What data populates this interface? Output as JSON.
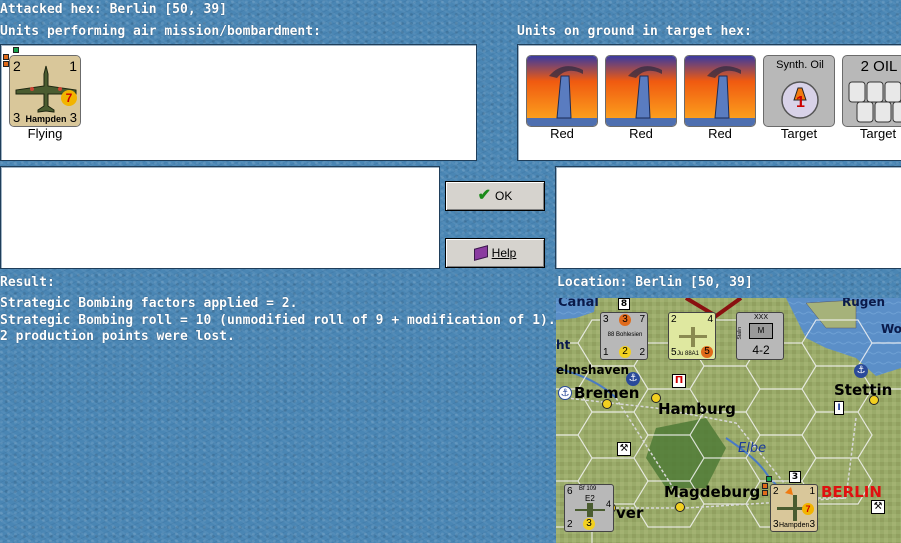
{
  "header": {
    "attacked_hex": "Attacked hex: Berlin [50, 39]"
  },
  "air_units": {
    "label": "Units performing air mission/bombardment:",
    "units": [
      {
        "name": "Hampden",
        "left_value": "2",
        "right_value": "1",
        "bottom_left": "3",
        "bottom_right": "3",
        "badge": "7",
        "caption": "Flying"
      }
    ]
  },
  "ground_units": {
    "label": "Units on ground in target hex:",
    "units": [
      {
        "type": "factory",
        "caption": "Red"
      },
      {
        "type": "factory",
        "caption": "Red"
      },
      {
        "type": "factory",
        "caption": "Red"
      },
      {
        "type": "synth-oil",
        "title": "Synth. Oil",
        "value": "1",
        "caption": "Target"
      },
      {
        "type": "oil",
        "title": "2 OIL",
        "caption": "Target"
      }
    ]
  },
  "buttons": {
    "ok": "OK",
    "help": "Help"
  },
  "result": {
    "label": "Result:",
    "lines": [
      "Strategic Bombing factors applied = 2.",
      "Strategic Bombing roll = 10 (unmodified roll of 9 + modification of 1).",
      "2 production points were lost."
    ]
  },
  "location": {
    "label": "Location: Berlin [50, 39]"
  },
  "map": {
    "places": {
      "canal": "Canal",
      "rugen": "Rügen",
      "wo": "Wo",
      "ht": "ht",
      "elmshaven": "elmshaven",
      "bremen": "Bremen",
      "hamburg": "Hamburg",
      "stettin": "Stettin",
      "elbe": "Elbe",
      "magdeburg": "Magdeburg",
      "ver": "ver",
      "berlin": "BERLIN"
    },
    "counters": {
      "bohlesien": {
        "name": "88 Bohlesien",
        "tl": "3",
        "tc": "3",
        "tr": "7",
        "bl": "1",
        "bc": "2",
        "br": "2"
      },
      "ju88": {
        "name": "Ju 88A1",
        "tl": "2",
        "tr": "4",
        "bl": "5",
        "br": "5"
      },
      "corps": {
        "size": "XXX",
        "value": "4-2",
        "side": "Stalin"
      },
      "bf109": {
        "name": "Bf 109",
        "sub": "E2",
        "tl": "6",
        "bl": "2",
        "bc": "3",
        "tr": "4"
      },
      "hampden": {
        "name": "Hampden",
        "tl": "2",
        "tr": "1",
        "bl": "3",
        "br": "3",
        "badge": "7"
      },
      "hex_marker": "8",
      "hex_marker2": "3"
    }
  },
  "colors": {
    "background": "#4a86b4",
    "berlin_red": "#e01010",
    "factory_sky": "#f05a10"
  }
}
